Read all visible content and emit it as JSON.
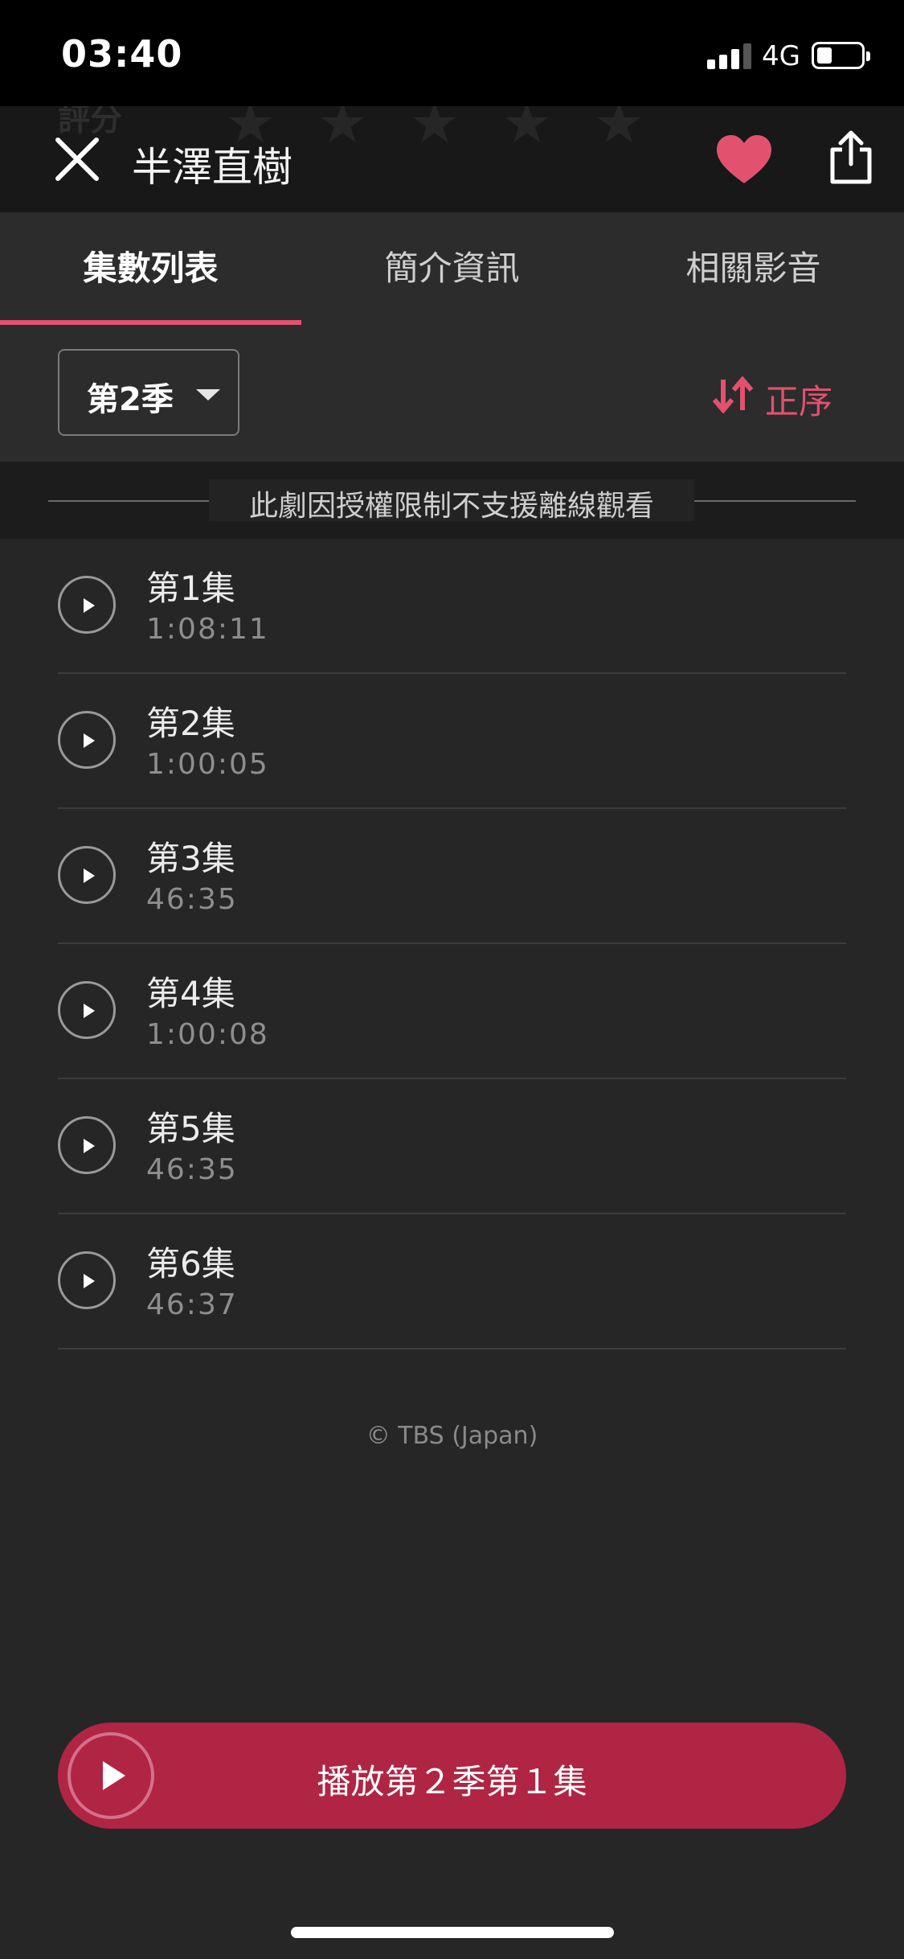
{
  "status_bar": {
    "time": "03:40",
    "network": "4G"
  },
  "header": {
    "title": "半澤直樹",
    "bg_label": "評分",
    "bg_stars": "★★★★★"
  },
  "tabs": [
    {
      "label": "集數列表",
      "active": true
    },
    {
      "label": "簡介資訊",
      "active": false
    },
    {
      "label": "相關影音",
      "active": false
    }
  ],
  "controls": {
    "season": "第2季",
    "sort_label": "正序"
  },
  "notice": "此劇因授權限制不支援離線觀看",
  "episodes": [
    {
      "title": "第1集",
      "duration": "1:08:11"
    },
    {
      "title": "第2集",
      "duration": "1:00:05"
    },
    {
      "title": "第3集",
      "duration": "46:35"
    },
    {
      "title": "第4集",
      "duration": "1:00:08"
    },
    {
      "title": "第5集",
      "duration": "46:35"
    },
    {
      "title": "第6集",
      "duration": "46:37"
    }
  ],
  "copyright": "© TBS (Japan)",
  "play_button": {
    "label": "播放第２季第１集"
  },
  "colors": {
    "accent": "#e2526f",
    "play_button": "#b02544",
    "background": "#262626"
  }
}
